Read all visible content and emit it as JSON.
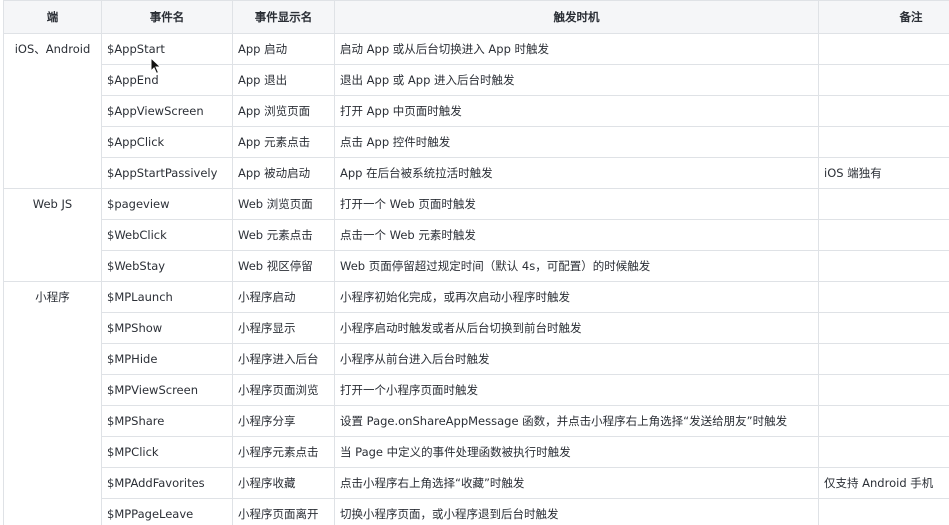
{
  "headers": [
    "端",
    "事件名",
    "事件显示名",
    "触发时机",
    "备注"
  ],
  "groups": [
    {
      "platform": "iOS、Android",
      "rows": [
        {
          "event": "$AppStart",
          "display": "App 启动",
          "trigger": "启动 App 或从后台切换进入 App 时触发",
          "note": ""
        },
        {
          "event": "$AppEnd",
          "display": "App 退出",
          "trigger": "退出 App 或 App 进入后台时触发",
          "note": ""
        },
        {
          "event": "$AppViewScreen",
          "display": "App 浏览页面",
          "trigger": "打开 App 中页面时触发",
          "note": ""
        },
        {
          "event": "$AppClick",
          "display": "App 元素点击",
          "trigger": "点击 App 控件时触发",
          "note": ""
        },
        {
          "event": "$AppStartPassively",
          "display": "App 被动启动",
          "trigger": "App 在后台被系统拉活时触发",
          "note": "iOS 端独有"
        }
      ]
    },
    {
      "platform": "Web JS",
      "rows": [
        {
          "event": "$pageview",
          "display": "Web 浏览页面",
          "trigger": "打开一个 Web 页面时触发",
          "note": ""
        },
        {
          "event": "$WebClick",
          "display": "Web 元素点击",
          "trigger": "点击一个 Web 元素时触发",
          "note": ""
        },
        {
          "event": "$WebStay",
          "display": "Web 视区停留",
          "trigger": "Web 页面停留超过规定时间（默认 4s，可配置）的时候触发",
          "note": ""
        }
      ]
    },
    {
      "platform": "小程序",
      "rows": [
        {
          "event": "$MPLaunch",
          "display": "小程序启动",
          "trigger": "小程序初始化完成，或再次启动小程序时触发",
          "note": ""
        },
        {
          "event": "$MPShow",
          "display": "小程序显示",
          "trigger": "小程序启动时触发或者从后台切换到前台时触发",
          "note": ""
        },
        {
          "event": "$MPHide",
          "display": "小程序进入后台",
          "trigger": "小程序从前台进入后台时触发",
          "note": ""
        },
        {
          "event": "$MPViewScreen",
          "display": "小程序页面浏览",
          "trigger": "打开一个小程序页面时触发",
          "note": ""
        },
        {
          "event": "$MPShare",
          "display": "小程序分享",
          "trigger": "设置 Page.onShareAppMessage 函数，并点击小程序右上角选择“发送给朋友”时触发",
          "note": ""
        },
        {
          "event": "$MPClick",
          "display": "小程序元素点击",
          "trigger": "当 Page 中定义的事件处理函数被执行时触发",
          "note": ""
        },
        {
          "event": "$MPAddFavorites",
          "display": "小程序收藏",
          "trigger": "点击小程序右上角选择“收藏”时触发",
          "note": "仅支持 Android 手机"
        },
        {
          "event": "$MPPageLeave",
          "display": "小程序页面离开",
          "trigger": "切换小程序页面，或小程序退到后台时触发",
          "note": ""
        }
      ]
    }
  ]
}
